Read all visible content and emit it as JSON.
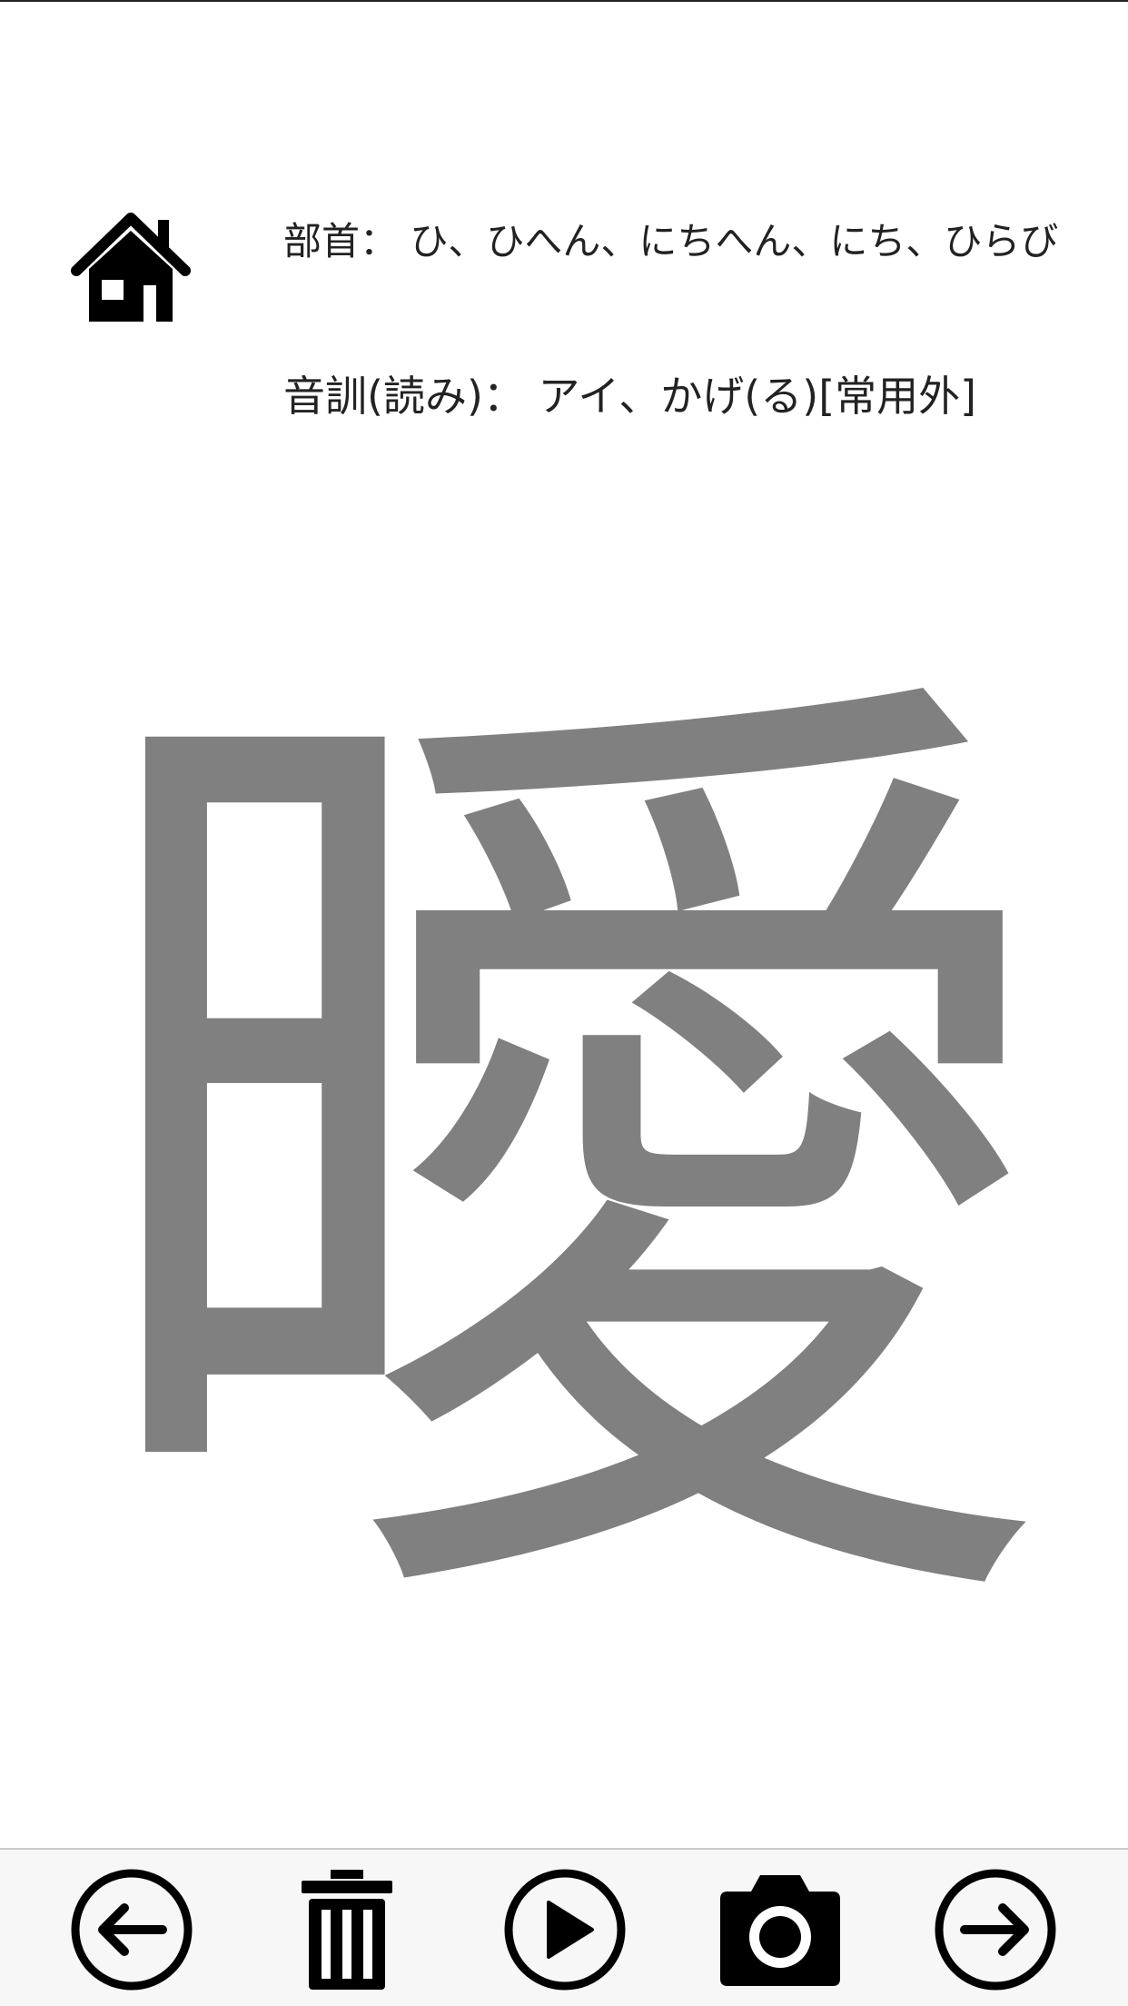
{
  "header": {
    "radical_label": "部首：",
    "radical_value": "ひ、ひへん、にちへん、にち、ひらび",
    "reading_label": "音訓(読み)：",
    "reading_value": "アイ、かげ(る)[常用外]"
  },
  "kanji": {
    "character": "曖",
    "color": "#808080"
  },
  "icons": {
    "home": "home-icon",
    "prev": "arrow-left-circle-icon",
    "delete": "trash-icon",
    "play": "play-circle-icon",
    "camera": "camera-icon",
    "next": "arrow-right-circle-icon"
  },
  "colors": {
    "icon": "#000000",
    "toolbar_bg": "#f7f7f7",
    "text": "#222222"
  }
}
